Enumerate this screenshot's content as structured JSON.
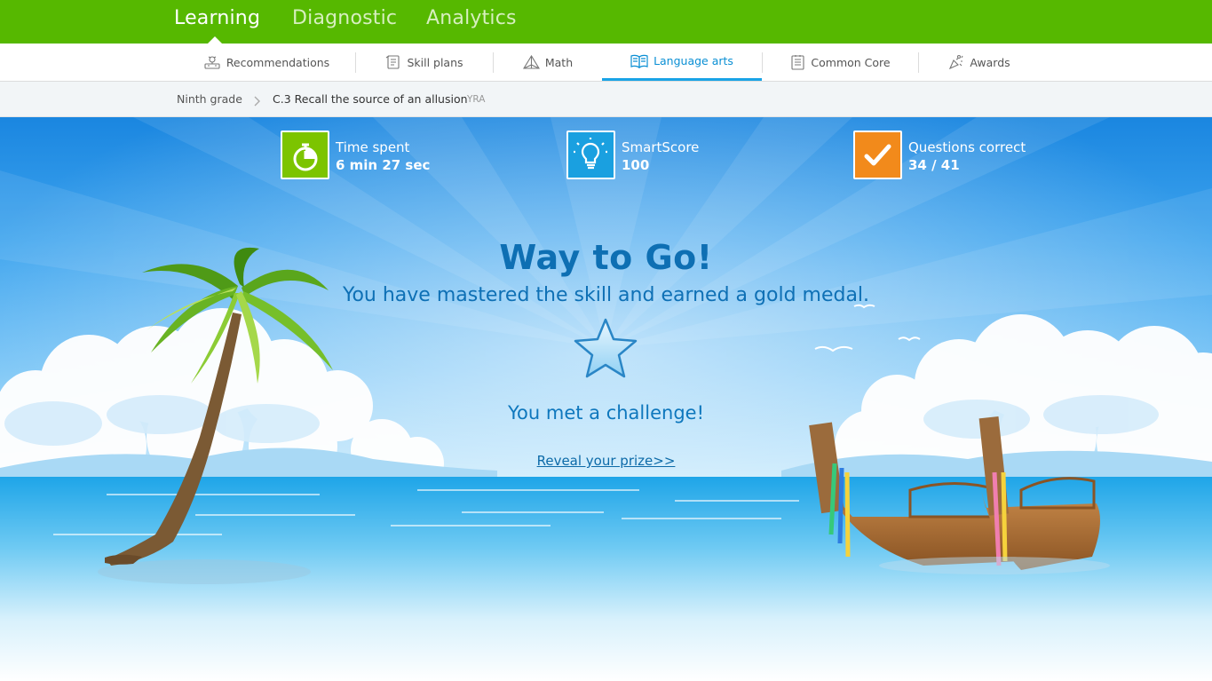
{
  "topnav": {
    "tabs": [
      "Learning",
      "Diagnostic",
      "Analytics"
    ],
    "active": "Learning"
  },
  "subnav": {
    "items": [
      {
        "label": "Recommendations",
        "icon": "recommendations-icon"
      },
      {
        "label": "Skill plans",
        "icon": "skill-plans-icon"
      },
      {
        "label": "Math",
        "icon": "math-pyramid-icon"
      },
      {
        "label": "Language arts",
        "icon": "language-arts-book-icon"
      },
      {
        "label": "Common Core",
        "icon": "common-core-icon"
      },
      {
        "label": "Awards",
        "icon": "awards-icon"
      }
    ],
    "active": "Language arts"
  },
  "breadcrumb": {
    "grade": "Ninth grade",
    "skill": "C.3 Recall the source of an allusion",
    "code": "YRA"
  },
  "stats": [
    {
      "label": "Time spent",
      "value": "6 min 27 sec",
      "icon": "stopwatch-icon",
      "color": "#7cc400"
    },
    {
      "label": "SmartScore",
      "value": "100",
      "icon": "lightbulb-icon",
      "color": "#1aa0e0"
    },
    {
      "label": "Questions correct",
      "value": "34 / 41",
      "icon": "checkmark-icon",
      "color": "#f28a1b"
    }
  ],
  "message": {
    "title": "Way to Go!",
    "subtitle": "You have mastered the skill and earned a gold medal.",
    "challenge": "You met a challenge!",
    "prize_link": "Reveal your prize>>"
  },
  "colors": {
    "brand_green": "#56b800",
    "accent_blue": "#19a3e6",
    "title_blue": "#0e6fb3"
  }
}
